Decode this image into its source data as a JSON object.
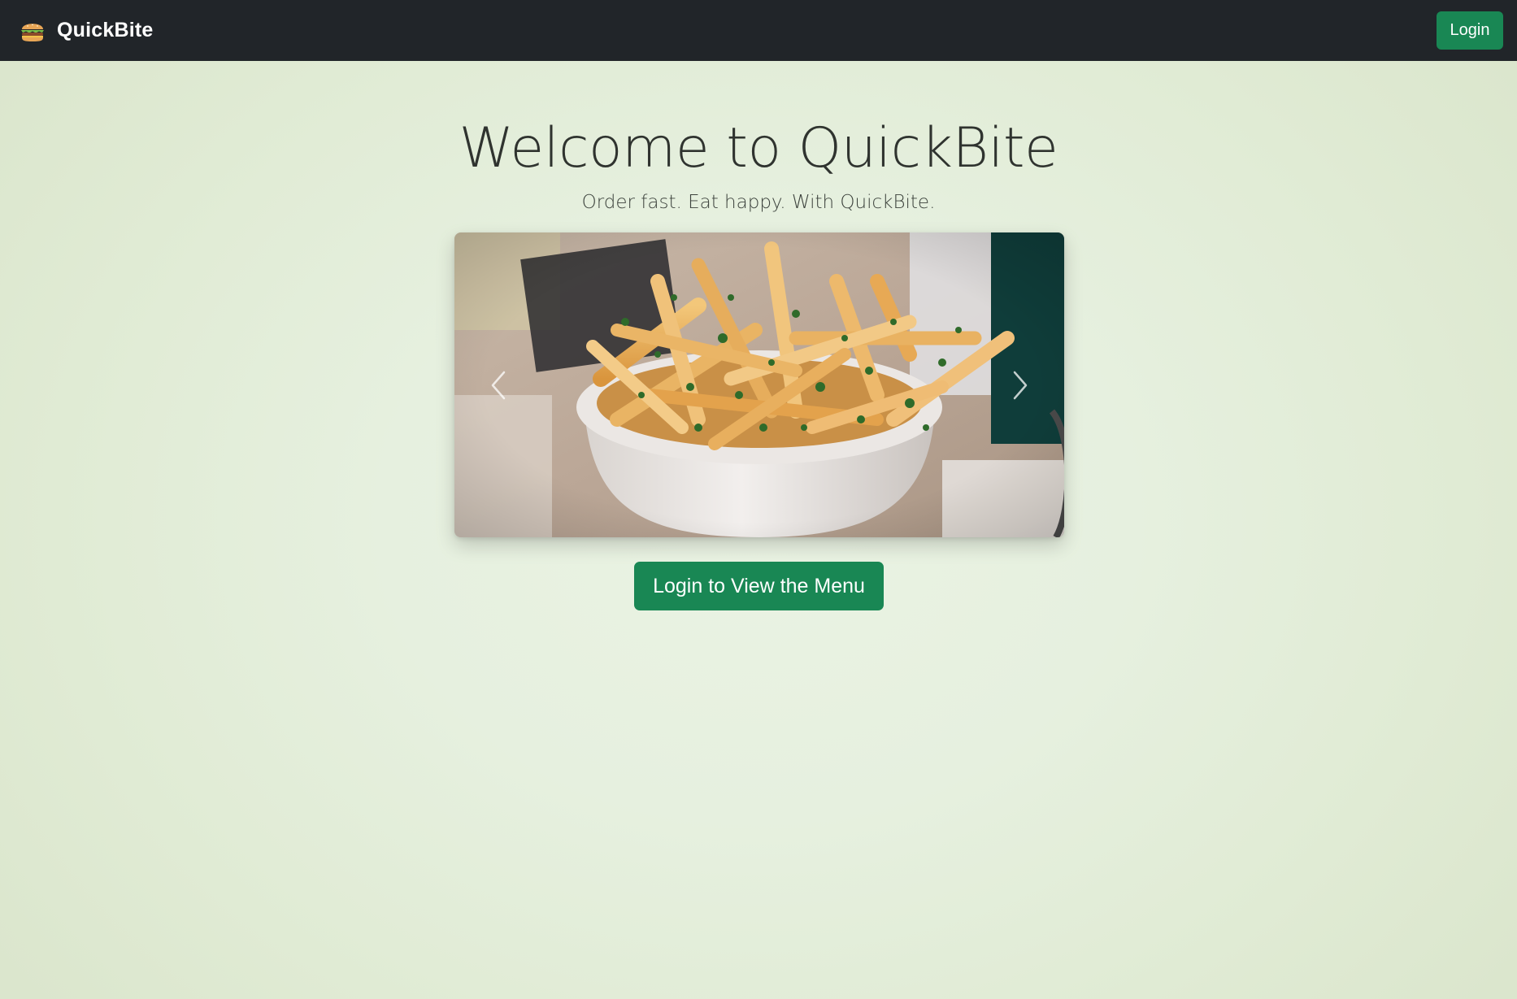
{
  "navbar": {
    "brand_name": "QuickBite",
    "brand_icon": "burger-icon",
    "login_label": "Login",
    "background": "#212529"
  },
  "hero": {
    "title": "Welcome to QuickBite",
    "subtitle": "Order fast. Eat happy. With QuickBite."
  },
  "carousel": {
    "image_subject": "french-fries-photo",
    "prev_icon": "chevron-left-icon",
    "next_icon": "chevron-right-icon"
  },
  "cta": {
    "label": "Login to View the Menu"
  },
  "colors": {
    "accent": "#198754",
    "page_background": "#e3eed9",
    "text": "#2f332f"
  }
}
